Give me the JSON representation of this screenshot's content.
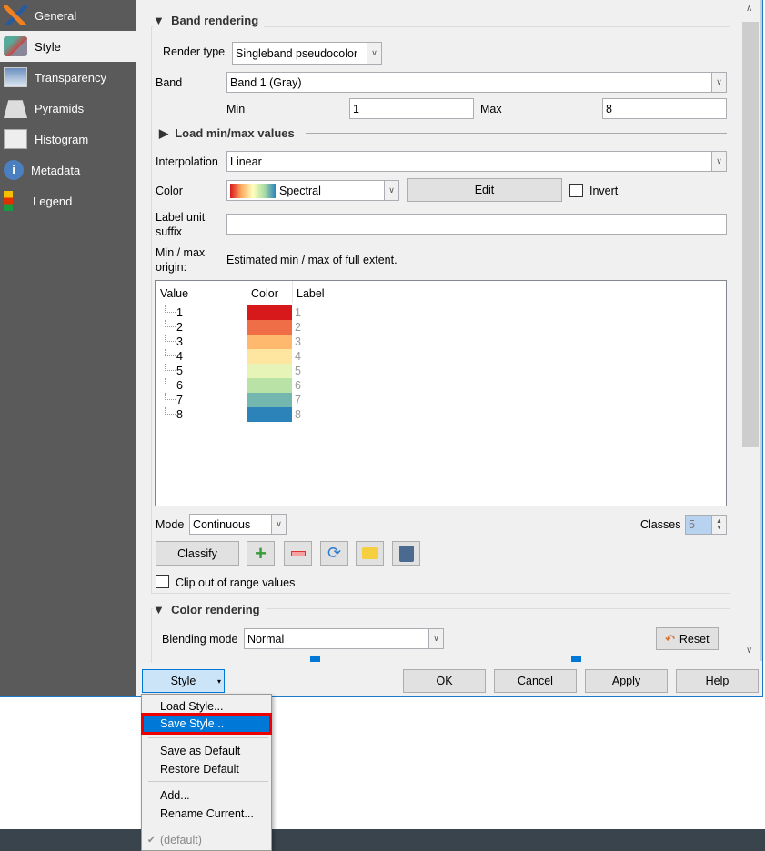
{
  "sidebar": {
    "items": [
      {
        "label": "General",
        "icon": "tools-icon"
      },
      {
        "label": "Style",
        "icon": "paintbrush-icon",
        "selected": true
      },
      {
        "label": "Transparency",
        "icon": "transparency-icon"
      },
      {
        "label": "Pyramids",
        "icon": "pyramids-icon"
      },
      {
        "label": "Histogram",
        "icon": "histogram-icon"
      },
      {
        "label": "Metadata",
        "icon": "info-icon"
      },
      {
        "label": "Legend",
        "icon": "legend-icon"
      }
    ]
  },
  "band": {
    "title": "Band rendering",
    "render_type_label": "Render type",
    "render_type": "Singleband pseudocolor",
    "band_label": "Band",
    "band": "Band 1 (Gray)",
    "min_label": "Min",
    "min": "1",
    "max_label": "Max",
    "max": "8",
    "load_minmax": "Load min/max values",
    "interp_label": "Interpolation",
    "interp": "Linear",
    "color_label": "Color",
    "color_ramp": "Spectral",
    "edit": "Edit",
    "invert": "Invert",
    "suffix_label": "Label unit suffix",
    "suffix": "",
    "origin_label": "Min / max origin:",
    "origin": "Estimated min / max of full extent.",
    "table": {
      "headers": [
        "Value",
        "Color",
        "Label"
      ],
      "rows": [
        {
          "value": "1",
          "color": "#d7191c",
          "label": "1"
        },
        {
          "value": "2",
          "color": "#ef6e48",
          "label": "2"
        },
        {
          "value": "3",
          "color": "#feb96e",
          "label": "3"
        },
        {
          "value": "4",
          "color": "#fee6a1",
          "label": "4"
        },
        {
          "value": "5",
          "color": "#e6f5b7",
          "label": "5"
        },
        {
          "value": "6",
          "color": "#b8e2a6",
          "label": "6"
        },
        {
          "value": "7",
          "color": "#74b7ae",
          "label": "7"
        },
        {
          "value": "8",
          "color": "#2b83ba",
          "label": "8"
        }
      ]
    },
    "mode_label": "Mode",
    "mode": "Continuous",
    "classes_label": "Classes",
    "classes": "5",
    "classify": "Classify",
    "clip": "Clip out of range values"
  },
  "color_rendering": {
    "title": "Color rendering",
    "blend_label": "Blending mode",
    "blend": "Normal",
    "reset": "Reset"
  },
  "footer": {
    "style": "Style",
    "ok": "OK",
    "cancel": "Cancel",
    "apply": "Apply",
    "help": "Help"
  },
  "menu": {
    "items": [
      "Load Style...",
      "Save Style...",
      "Save as Default",
      "Restore Default",
      "Add...",
      "Rename Current...",
      "(default)"
    ],
    "highlighted": "Save Style..."
  }
}
